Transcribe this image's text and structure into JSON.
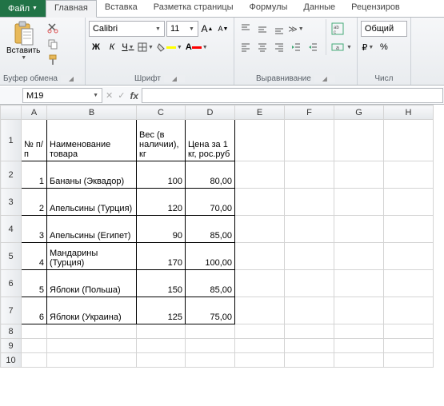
{
  "tabs": {
    "file": "Файл",
    "items": [
      "Главная",
      "Вставка",
      "Разметка страницы",
      "Формулы",
      "Данные",
      "Рецензиров"
    ]
  },
  "ribbon": {
    "clipboard": {
      "paste": "Вставить",
      "label": "Буфер обмена"
    },
    "font": {
      "name": "Calibri",
      "size": "11",
      "label": "Шрифт",
      "bold": "Ж",
      "italic": "К",
      "underline": "Ч"
    },
    "alignment": {
      "label": "Выравнивание"
    },
    "number": {
      "format": "Общий",
      "label": "Числ"
    }
  },
  "namebox": "M19",
  "columns": [
    "A",
    "B",
    "C",
    "D",
    "E",
    "F",
    "G",
    "H"
  ],
  "headers": {
    "a": "№ п/п",
    "b": "Наименование товара",
    "c": "Вес (в наличии), кг",
    "d": "Цена за 1 кг, рос.руб"
  },
  "rows": [
    {
      "n": "1",
      "name": "Бананы (Эквадор)",
      "w": "100",
      "p": "80,00"
    },
    {
      "n": "2",
      "name": "Апельсины (Турция)",
      "w": "120",
      "p": "70,00"
    },
    {
      "n": "3",
      "name": "Апельсины (Египет)",
      "w": "90",
      "p": "85,00"
    },
    {
      "n": "4",
      "name": "Мандарины (Турция)",
      "w": "170",
      "p": "100,00"
    },
    {
      "n": "5",
      "name": "Яблоки (Польша)",
      "w": "150",
      "p": "85,00"
    },
    {
      "n": "6",
      "name": "Яблоки (Украина)",
      "w": "125",
      "p": "75,00"
    }
  ],
  "chart_data": {
    "type": "table",
    "columns": [
      "№ п/п",
      "Наименование товара",
      "Вес (в наличии), кг",
      "Цена за 1 кг, рос.руб"
    ],
    "rows": [
      [
        1,
        "Бананы (Эквадор)",
        100,
        80.0
      ],
      [
        2,
        "Апельсины (Турция)",
        120,
        70.0
      ],
      [
        3,
        "Апельсины (Египет)",
        90,
        85.0
      ],
      [
        4,
        "Мандарины (Турция)",
        170,
        100.0
      ],
      [
        5,
        "Яблоки (Польша)",
        150,
        85.0
      ],
      [
        6,
        "Яблоки (Украина)",
        125,
        75.0
      ]
    ]
  }
}
